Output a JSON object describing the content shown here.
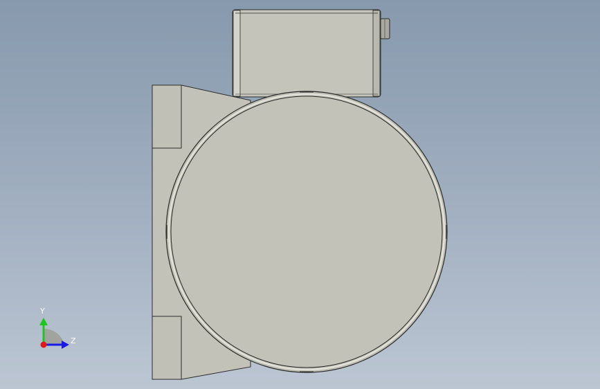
{
  "triad": {
    "y_label": "Y",
    "z_label": "Z"
  },
  "colors": {
    "background_top": "#8799ad",
    "background_bottom": "#bcc6d3",
    "part_face": "#c2c2b9",
    "part_edge": "#2a2a2a",
    "axis_y": "#1fc61f",
    "axis_z": "#1a1ae6",
    "axis_x_origin": "#e01818"
  }
}
